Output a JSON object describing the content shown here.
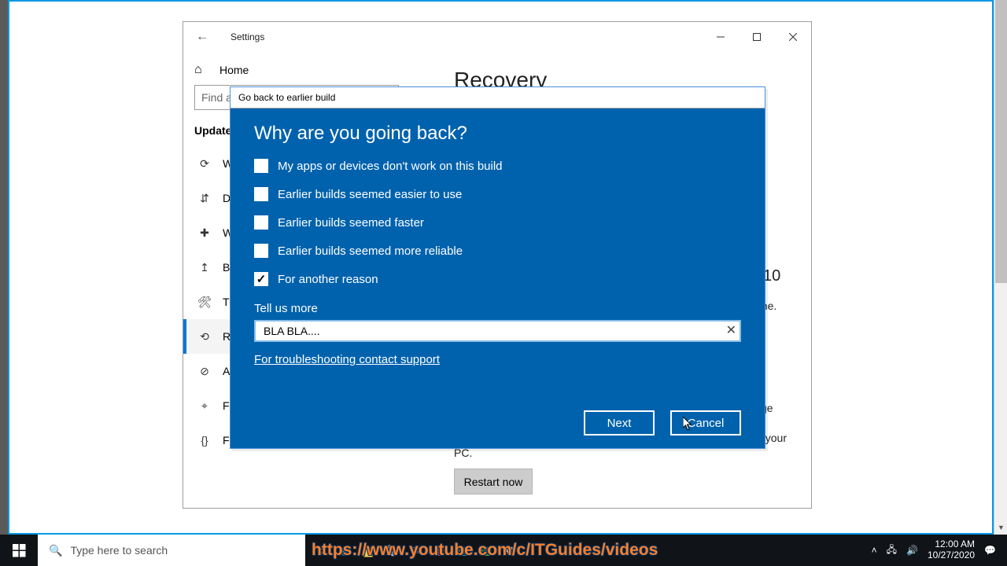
{
  "settings": {
    "title": "Settings",
    "home": "Home",
    "search_placeholder": "Find a setting",
    "section": "Update & Security",
    "nav": [
      "Windows Update",
      "Delivery Optimization",
      "Windows Security",
      "Backup",
      "Troubleshoot",
      "Recovery",
      "Activation",
      "Find my device",
      "For developers"
    ],
    "page_heading": "Recovery",
    "side_head": "10",
    "side_text": "one.",
    "advanced_text": "Change restore Windows from a system image. This will restart your PC.",
    "restart": "Restart now"
  },
  "dialog": {
    "title": "Go back to earlier build",
    "heading": "Why are you going back?",
    "options": [
      {
        "label": "My apps or devices don't work on this build",
        "checked": false
      },
      {
        "label": "Earlier builds seemed easier to use",
        "checked": false
      },
      {
        "label": "Earlier builds seemed faster",
        "checked": false
      },
      {
        "label": "Earlier builds seemed more reliable",
        "checked": false
      },
      {
        "label": "For another reason",
        "checked": true
      }
    ],
    "tell_us": "Tell us more",
    "textbox": "BLA BLA....",
    "support_link": "For troubleshooting contact support",
    "next": "Next",
    "cancel": "Cancel"
  },
  "taskbar": {
    "search": "Type here to search",
    "overlay": "https://www.youtube.com/c/ITGuides/videos",
    "time": "12:00 AM",
    "date": "10/27/2020"
  }
}
